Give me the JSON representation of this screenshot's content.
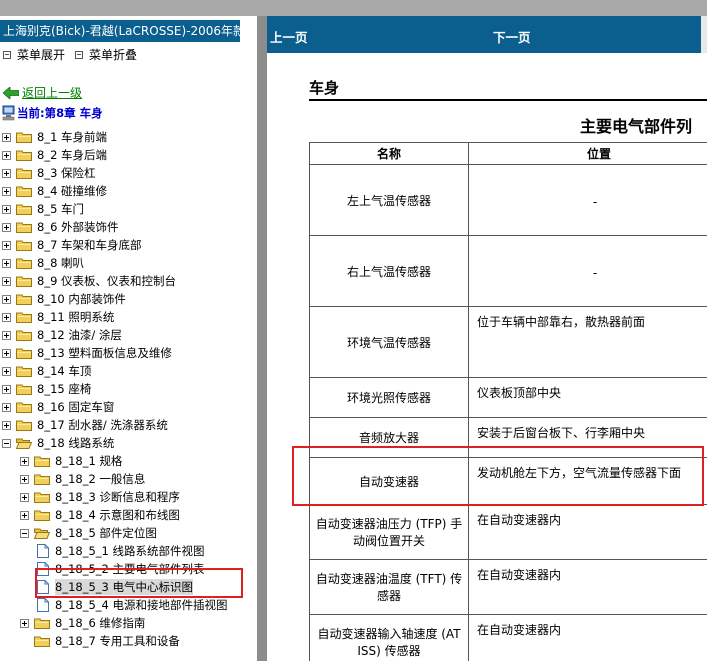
{
  "left_pane": {
    "title": "上海别克(Bick)-君越(LaCROSSE)-2006年款",
    "menu_expand": "菜单展开",
    "menu_collapse": "菜单折叠",
    "back_label": "返回上一级",
    "current_label": "当前:第8章 车身",
    "tree": [
      {
        "label": "8_1 车身前端",
        "type": "folder",
        "expander": "plus",
        "level": 0
      },
      {
        "label": "8_2 车身后端",
        "type": "folder",
        "expander": "plus",
        "level": 0
      },
      {
        "label": "8_3 保险杠",
        "type": "folder",
        "expander": "plus",
        "level": 0
      },
      {
        "label": "8_4 碰撞维修",
        "type": "folder",
        "expander": "plus",
        "level": 0
      },
      {
        "label": "8_5 车门",
        "type": "folder",
        "expander": "plus",
        "level": 0
      },
      {
        "label": "8_6 外部装饰件",
        "type": "folder",
        "expander": "plus",
        "level": 0
      },
      {
        "label": "8_7 车架和车身底部",
        "type": "folder",
        "expander": "plus",
        "level": 0
      },
      {
        "label": "8_8 喇叭",
        "type": "folder",
        "expander": "plus",
        "level": 0
      },
      {
        "label": "8_9 仪表板、仪表和控制台",
        "type": "folder",
        "expander": "plus",
        "level": 0
      },
      {
        "label": "8_10 内部装饰件",
        "type": "folder",
        "expander": "plus",
        "level": 0
      },
      {
        "label": "8_11 照明系统",
        "type": "folder",
        "expander": "plus",
        "level": 0
      },
      {
        "label": "8_12 油漆/ 涂层",
        "type": "folder",
        "expander": "plus",
        "level": 0
      },
      {
        "label": "8_13 塑料面板信息及维修",
        "type": "folder",
        "expander": "plus",
        "level": 0
      },
      {
        "label": "8_14 车顶",
        "type": "folder",
        "expander": "plus",
        "level": 0
      },
      {
        "label": "8_15 座椅",
        "type": "folder",
        "expander": "plus",
        "level": 0
      },
      {
        "label": "8_16 固定车窗",
        "type": "folder",
        "expander": "plus",
        "level": 0
      },
      {
        "label": "8_17 刮水器/ 洗涤器系统",
        "type": "folder",
        "expander": "plus",
        "level": 0
      },
      {
        "label": "8_18 线路系统",
        "type": "folder",
        "expander": "minus",
        "level": 0
      },
      {
        "label": "8_18_1 规格",
        "type": "folder",
        "expander": "plus",
        "level": 1
      },
      {
        "label": "8_18_2 一般信息",
        "type": "folder",
        "expander": "plus",
        "level": 1
      },
      {
        "label": "8_18_3 诊断信息和程序",
        "type": "folder",
        "expander": "plus",
        "level": 1
      },
      {
        "label": "8_18_4 示意图和布线图",
        "type": "folder",
        "expander": "plus",
        "level": 1
      },
      {
        "label": "8_18_5 部件定位图",
        "type": "folder",
        "expander": "minus",
        "level": 1
      },
      {
        "label": "8_18_5_1 线路系统部件视图",
        "type": "doc",
        "expander": "none",
        "level": 2
      },
      {
        "label": "8_18_5_2 主要电气部件列表",
        "type": "doc",
        "expander": "none",
        "level": 2
      },
      {
        "label": "8_18_5_3 电气中心标识图",
        "type": "doc",
        "expander": "none",
        "level": 2,
        "selected": true
      },
      {
        "label": "8_18_5_4 电源和接地部件插视图",
        "type": "doc",
        "expander": "none",
        "level": 2
      },
      {
        "label": "8_18_6 维修指南",
        "type": "folder",
        "expander": "plus",
        "level": 1
      },
      {
        "label": "8_18_7 专用工具和设备",
        "type": "folder",
        "expander": "none",
        "level": 1
      }
    ]
  },
  "right_pane": {
    "nav_prev": "上一页",
    "nav_next": "下一页",
    "section_title": "车身",
    "table_title": "主要电气部件列",
    "col_name": "名称",
    "col_location": "位置",
    "rows": [
      {
        "name": "左上气温传感器",
        "location": "-"
      },
      {
        "name": "右上气温传感器",
        "location": "-"
      },
      {
        "name": "环境气温传感器",
        "location": "位于车辆中部靠右，散热器前面"
      },
      {
        "name": "环境光照传感器",
        "location": "仪表板顶部中央"
      },
      {
        "name": "音频放大器",
        "location": "安装于后窗台板下、行李厢中央"
      },
      {
        "name": "自动变速器",
        "location": "发动机舱左下方，空气流量传感器下面"
      },
      {
        "name": "自动变速器油压力 (TFP) 手动阀位置开关",
        "location": "在自动变速器内"
      },
      {
        "name": "自动变速器油温度 (TFT) 传感器",
        "location": "在自动变速器内"
      },
      {
        "name": "自动变速器输入轴速度 (AT ISS) 传感器",
        "location": "在自动变速器内"
      }
    ]
  },
  "colors": {
    "title_bar": "#0b5f8f",
    "highlight": "#e02020",
    "link_green": "#008000",
    "current_blue": "#0000cc"
  }
}
